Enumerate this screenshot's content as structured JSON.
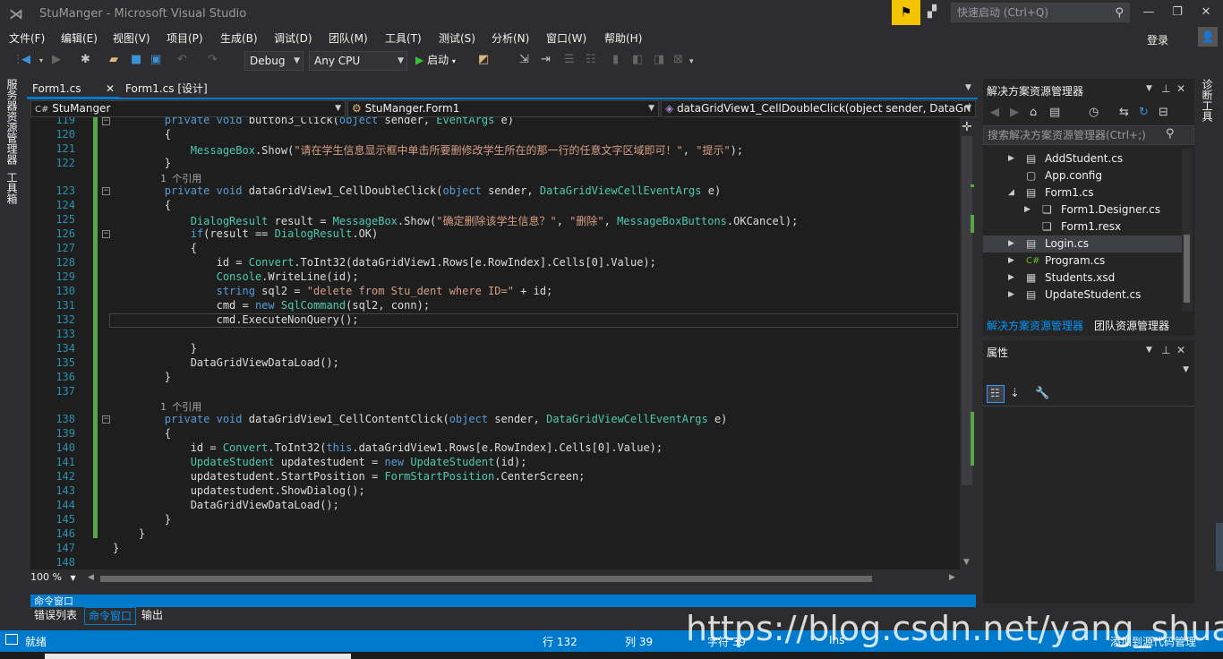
{
  "window": {
    "title": "StuManger - Microsoft Visual Studio",
    "quick_launch_placeholder": "快速启动 (Ctrl+Q)",
    "login": "登录"
  },
  "menu": [
    "文件(F)",
    "编辑(E)",
    "视图(V)",
    "项目(P)",
    "生成(B)",
    "调试(D)",
    "团队(M)",
    "工具(T)",
    "测试(S)",
    "分析(N)",
    "窗口(W)",
    "帮助(H)"
  ],
  "toolbar": {
    "config": "Debug",
    "platform": "Any CPU",
    "start_label": "启动"
  },
  "left_vtabs": [
    "服务器资源管理器",
    "工具箱"
  ],
  "right_vtab": "诊断工具",
  "doc_tabs": {
    "active": "Form1.cs",
    "second": "Form1.cs [设计]"
  },
  "navbar": {
    "project": "StuManger",
    "class": "StuManger.Form1",
    "member": "dataGridView1_CellDoubleClick(object sender, DataGri"
  },
  "editor": {
    "ref_label": "1 个引用",
    "line_numbers": [
      "119",
      "120",
      "121",
      "122",
      "",
      "123",
      "124",
      "125",
      "126",
      "127",
      "128",
      "129",
      "130",
      "131",
      "132",
      "133",
      "134",
      "135",
      "136",
      "137",
      "",
      "138",
      "139",
      "140",
      "141",
      "142",
      "143",
      "144",
      "145",
      "146",
      "147",
      "148"
    ]
  },
  "zoom": "100 %",
  "bottom_panel": {
    "title": "命令窗口",
    "tabs": [
      "错误列表",
      "命令窗口",
      "输出"
    ]
  },
  "solution_explorer": {
    "title": "解决方案资源管理器",
    "search_placeholder": "搜索解决方案资源管理器(Ctrl+;)",
    "items": [
      {
        "label": "AddStudent.cs",
        "icon": "form-icon"
      },
      {
        "label": "App.config",
        "icon": "config-icon"
      },
      {
        "label": "Form1.cs",
        "icon": "form-icon"
      },
      {
        "label": "Form1.Designer.cs",
        "icon": "cs-file-icon"
      },
      {
        "label": "Form1.resx",
        "icon": "resx-icon"
      },
      {
        "label": "Login.cs",
        "icon": "form-icon"
      },
      {
        "label": "Program.cs",
        "icon": "csharp-icon"
      },
      {
        "label": "Students.xsd",
        "icon": "dataset-icon"
      },
      {
        "label": "UpdateStudent.cs",
        "icon": "form-icon"
      }
    ],
    "bottom_tabs": [
      "解决方案资源管理器",
      "团队资源管理器"
    ]
  },
  "properties": {
    "title": "属性"
  },
  "status": {
    "ready": "就绪",
    "line": "行 132",
    "col": "列 39",
    "char": "字符 39",
    "ins": "Ins",
    "source_control": "添加到源代码管理"
  },
  "watermark": "https://blog.csdn.net/yang_shuai"
}
